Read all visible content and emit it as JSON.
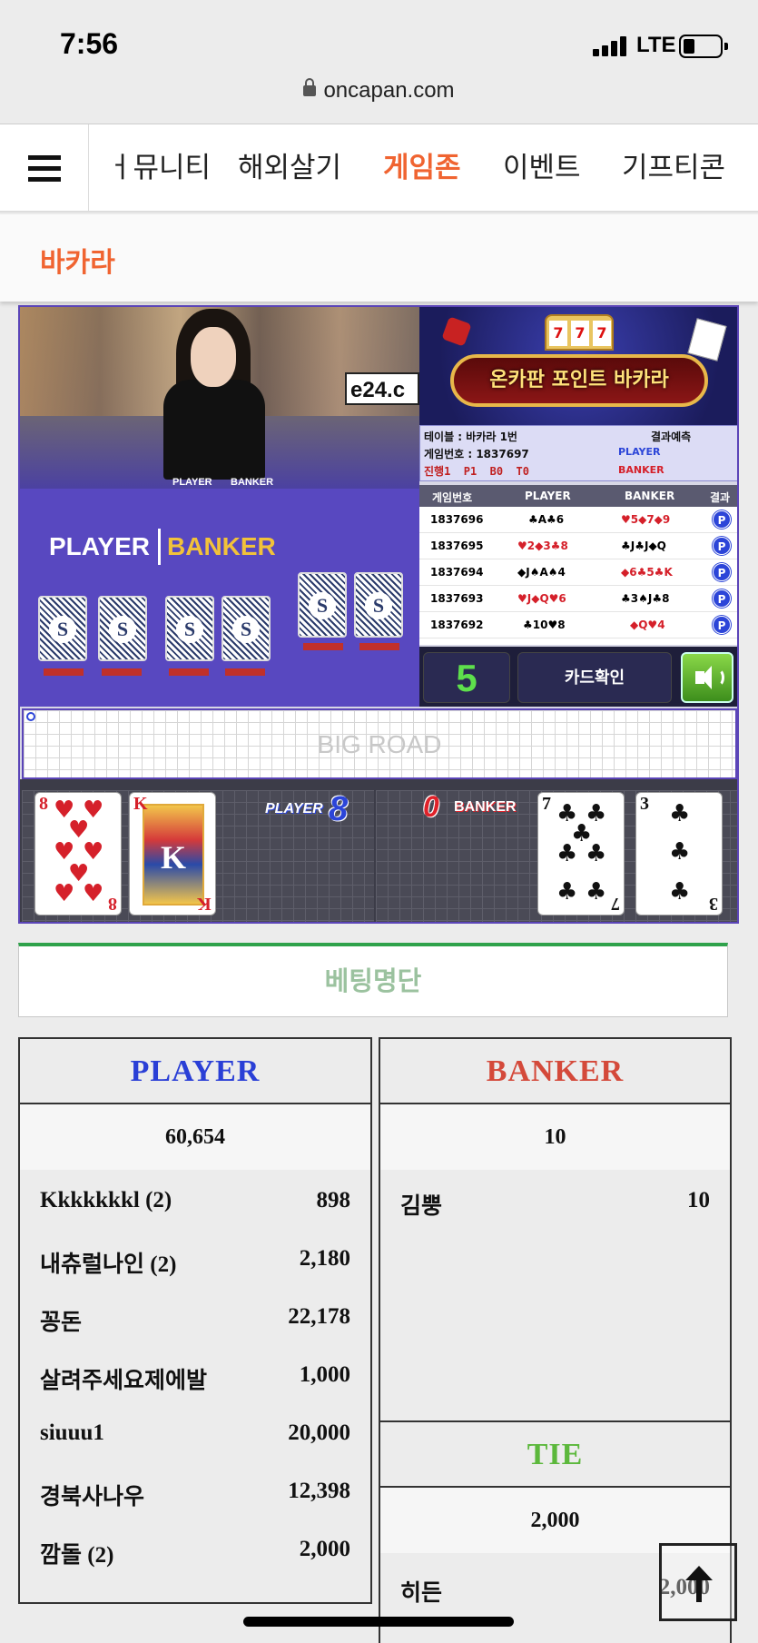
{
  "status_bar": {
    "time": "7:56",
    "network": "LTE"
  },
  "browser": {
    "url": "oncapan.com"
  },
  "nav": {
    "items": [
      "ㅓ뮤니티",
      "해외살기",
      "게임존",
      "이벤트",
      "기프티콘"
    ],
    "active_index": 2,
    "active_color": "#f06431"
  },
  "subnav": {
    "title": "바카라"
  },
  "game": {
    "video": {
      "overlay_text": "e24.c",
      "small_player": "PLAYER",
      "small_banker": "BANKER",
      "table_player": "PLAYER",
      "table_banker": "BANKER",
      "shoe_mark": "SKY"
    },
    "banner": {
      "title": "온카판 포인트 바카라",
      "slot": [
        "7",
        "7",
        "7"
      ]
    },
    "info": {
      "table": "테이블 : 바카라 1번",
      "game_no": "게임번호 : 1837697",
      "progress": "진행1  P1  B0  T0",
      "predict_label": "결과예측",
      "predict_player": "PLAYER",
      "predict_banker": "BANKER"
    },
    "history": {
      "headers": [
        "게임번호",
        "PLAYER",
        "BANKER",
        "결과"
      ],
      "rows": [
        {
          "no": "1837696",
          "player": "♣A♣6",
          "banker": "♥5◆7◆9",
          "result": "P"
        },
        {
          "no": "1837695",
          "player": "♥2◆3♣8",
          "banker": "♣J♣J◆Q",
          "result": "P"
        },
        {
          "no": "1837694",
          "player": "◆J♠A♠4",
          "banker": "◆6♣5♣K",
          "result": "P"
        },
        {
          "no": "1837693",
          "player": "♥J◆Q♥6",
          "banker": "♣3♠J♣8",
          "result": "P"
        },
        {
          "no": "1837692",
          "player": "♣10♥8",
          "banker": "◆Q♥4",
          "result": "P"
        }
      ]
    },
    "controls": {
      "countdown": "5",
      "card_check": "카드확인"
    },
    "bigroad_label": "BIG ROAD",
    "player_hand": {
      "label": "PLAYER",
      "score": "8",
      "cards": [
        {
          "rank": "8",
          "suit": "♥"
        },
        {
          "rank": "K",
          "suit": "♥"
        }
      ]
    },
    "banker_hand": {
      "label": "BANKER",
      "score": "0",
      "cards": [
        {
          "rank": "7",
          "suit": "♣"
        },
        {
          "rank": "3",
          "suit": "♣"
        }
      ]
    }
  },
  "betting": {
    "header": "베팅명단",
    "player": {
      "title": "PLAYER",
      "color": "#2a3fd6",
      "total": "60,654",
      "bets": [
        {
          "name": "Kkkkkkkl (2)",
          "amount": "898"
        },
        {
          "name": "내츄럴나인 (2)",
          "amount": "2,180"
        },
        {
          "name": "꽁돈",
          "amount": "22,178"
        },
        {
          "name": "살려주세요제에발",
          "amount": "1,000"
        },
        {
          "name": "siuuu1",
          "amount": "20,000"
        },
        {
          "name": "경북사나우",
          "amount": "12,398"
        },
        {
          "name": "깜돌 (2)",
          "amount": "2,000"
        }
      ]
    },
    "banker": {
      "title": "BANKER",
      "color": "#d4493a",
      "total": "10",
      "bets": [
        {
          "name": "김뿡",
          "amount": "10"
        }
      ]
    },
    "tie": {
      "title": "TIE",
      "color": "#5cb83c",
      "total": "2,000",
      "bets": [
        {
          "name": "히든",
          "amount": "2,000"
        }
      ]
    }
  }
}
